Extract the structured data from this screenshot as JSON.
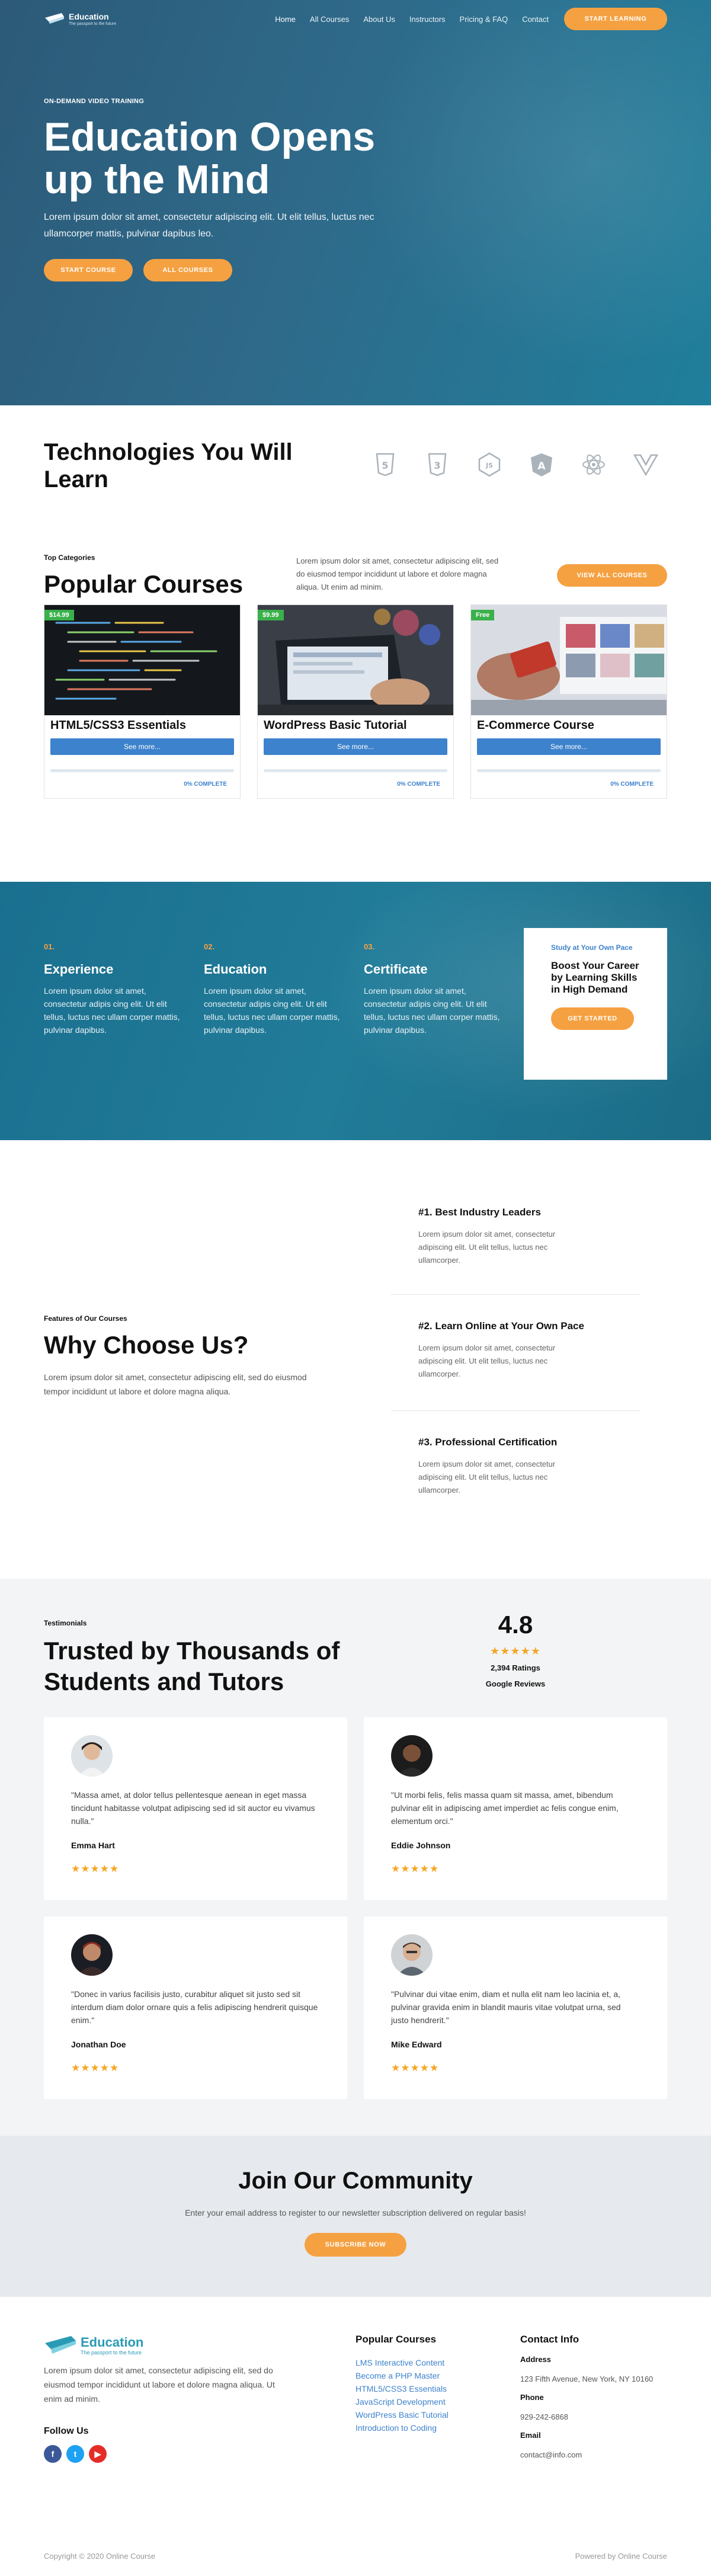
{
  "colors": {
    "accent": "#f5a142",
    "primary_blue": "#3d82cc",
    "hero": "#2c5a78",
    "band": "#1a6f8f",
    "star": "#f5a623",
    "price_badge": "#3ab14b"
  },
  "header": {
    "logo_name": "Education",
    "logo_tagline": "The passport to the future",
    "nav": [
      {
        "label": "Home",
        "active": true
      },
      {
        "label": "All Courses"
      },
      {
        "label": "About Us"
      },
      {
        "label": "Instructors"
      },
      {
        "label": "Pricing & FAQ"
      },
      {
        "label": "Contact"
      }
    ],
    "cta": "START LEARNING"
  },
  "hero": {
    "kicker": "ON-DEMAND VIDEO TRAINING",
    "title": "Education Opens up the Mind",
    "text": "Lorem ipsum dolor sit amet, consectetur adipiscing elit. Ut elit tellus, luctus nec ullamcorper mattis, pulvinar dapibus leo.",
    "btn_start": "START COURSE",
    "btn_all": "ALL COURSES"
  },
  "technologies": {
    "title": "Technologies You Will Learn",
    "icons": [
      "html5-icon",
      "css3-icon",
      "nodejs-icon",
      "angular-icon",
      "react-icon",
      "vue-icon"
    ]
  },
  "courses": {
    "kicker": "Top Categories",
    "title": "Popular Courses",
    "intro": "Lorem ipsum dolor sit amet, consectetur adipiscing elit, sed do eiusmod tempor incididunt ut labore et dolore magna aliqua. Ut enim ad minim.",
    "view_all": "VIEW ALL COURSES",
    "items": [
      {
        "price": "$14.99",
        "title": "HTML5/CSS3 Essentials",
        "button": "See more...",
        "progress": 0,
        "status": "0% COMPLETE"
      },
      {
        "price": "$9.99",
        "title": "WordPress Basic Tutorial",
        "button": "See more...",
        "progress": 0,
        "status": "0% COMPLETE"
      },
      {
        "price": "Free",
        "title": "E-Commerce Course",
        "button": "See more...",
        "progress": 0,
        "status": "0% COMPLETE"
      }
    ]
  },
  "features": {
    "items": [
      {
        "num": "01.",
        "title": "Experience",
        "text": "Lorem ipsum dolor sit amet, consectetur adipis cing elit. Ut elit tellus, luctus nec ullam corper mattis, pulvinar dapibus."
      },
      {
        "num": "02.",
        "title": "Education",
        "text": "Lorem ipsum dolor sit amet, consectetur adipis cing elit. Ut elit tellus, luctus nec ullam corper mattis, pulvinar dapibus."
      },
      {
        "num": "03.",
        "title": "Certificate",
        "text": "Lorem ipsum dolor sit amet, consectetur adipis cing elit. Ut elit tellus, luctus nec ullam corper mattis, pulvinar dapibus."
      }
    ],
    "card_small": "Study at Your Own Pace",
    "card_title": "Boost Your Career by Learning Skills in High Demand",
    "card_button": "GET STARTED"
  },
  "why": {
    "kicker": "Features of Our Courses",
    "title": "Why Choose Us?",
    "intro": "Lorem ipsum dolor sit amet, consectetur adipiscing elit, sed do eiusmod tempor incididunt ut labore et dolore magna aliqua.",
    "items": [
      {
        "title": "#1. Best Industry Leaders",
        "text": "Lorem ipsum dolor sit amet, consectetur adipiscing elit. Ut elit tellus, luctus nec ullamcorper."
      },
      {
        "title": "#2. Learn Online at Your Own Pace",
        "text": "Lorem ipsum dolor sit amet, consectetur adipiscing elit. Ut elit tellus, luctus nec ullamcorper."
      },
      {
        "title": "#3. Professional Certification",
        "text": "Lorem ipsum dolor sit amet, consectetur adipiscing elit. Ut elit tellus, luctus nec ullamcorper."
      }
    ]
  },
  "testimonials": {
    "kicker": "Testimonials",
    "title": "Trusted by Thousands of Students and Tutors",
    "score": "4.8",
    "stars": "★★★★★",
    "ratings": "2,394 Ratings",
    "source": "Google Reviews",
    "items": [
      {
        "quote": "\"Massa amet, at dolor tellus pellentesque aenean in eget massa tincidunt habitasse volutpat adipiscing sed id sit auctor eu vivamus nulla.\"",
        "name": "Emma Hart",
        "stars": "★★★★★"
      },
      {
        "quote": "\"Ut morbi felis, felis massa quam sit massa, amet, bibendum pulvinar elit in adipiscing amet imperdiet ac felis congue enim, elementum orci.\"",
        "name": "Eddie Johnson",
        "stars": "★★★★★"
      },
      {
        "quote": "\"Donec in varius facilisis justo, curabitur aliquet sit justo sed sit interdum diam dolor ornare quis a felis adipiscing hendrerit quisque enim.\"",
        "name": "Jonathan Doe",
        "stars": "★★★★★"
      },
      {
        "quote": "\"Pulvinar dui vitae enim, diam et nulla elit nam leo lacinia et, a, pulvinar gravida enim in blandit mauris vitae volutpat urna, sed justo hendrerit.\"",
        "name": "Mike Edward",
        "stars": "★★★★★"
      }
    ]
  },
  "community": {
    "title": "Join Our Community",
    "text": "Enter your email address to register to our newsletter subscription delivered on regular basis!",
    "button": "SUBSCRIBE NOW"
  },
  "footer": {
    "logo_name": "Education",
    "logo_tagline": "The passport to the future",
    "about": "Lorem ipsum dolor sit amet, consectetur adipiscing elit, sed do eiusmod tempor incididunt ut labore et dolore magna aliqua. Ut enim ad minim.",
    "follow": "Follow Us",
    "courses_title": "Popular Courses",
    "courses": [
      "LMS Interactive Content",
      "Become a PHP Master",
      "HTML5/CSS3 Essentials",
      "JavaScript Development",
      "WordPress Basic Tutorial",
      "Introduction to Coding"
    ],
    "contact_title": "Contact Info",
    "address_label": "Address",
    "address": "123 Fifth Avenue, New York, NY 10160",
    "phone_label": "Phone",
    "phone": "929-242-6868",
    "email_label": "Email",
    "email": "contact@info.com",
    "copyright": "Copyright © 2020 Online Course",
    "powered": "Powered by Online Course"
  }
}
